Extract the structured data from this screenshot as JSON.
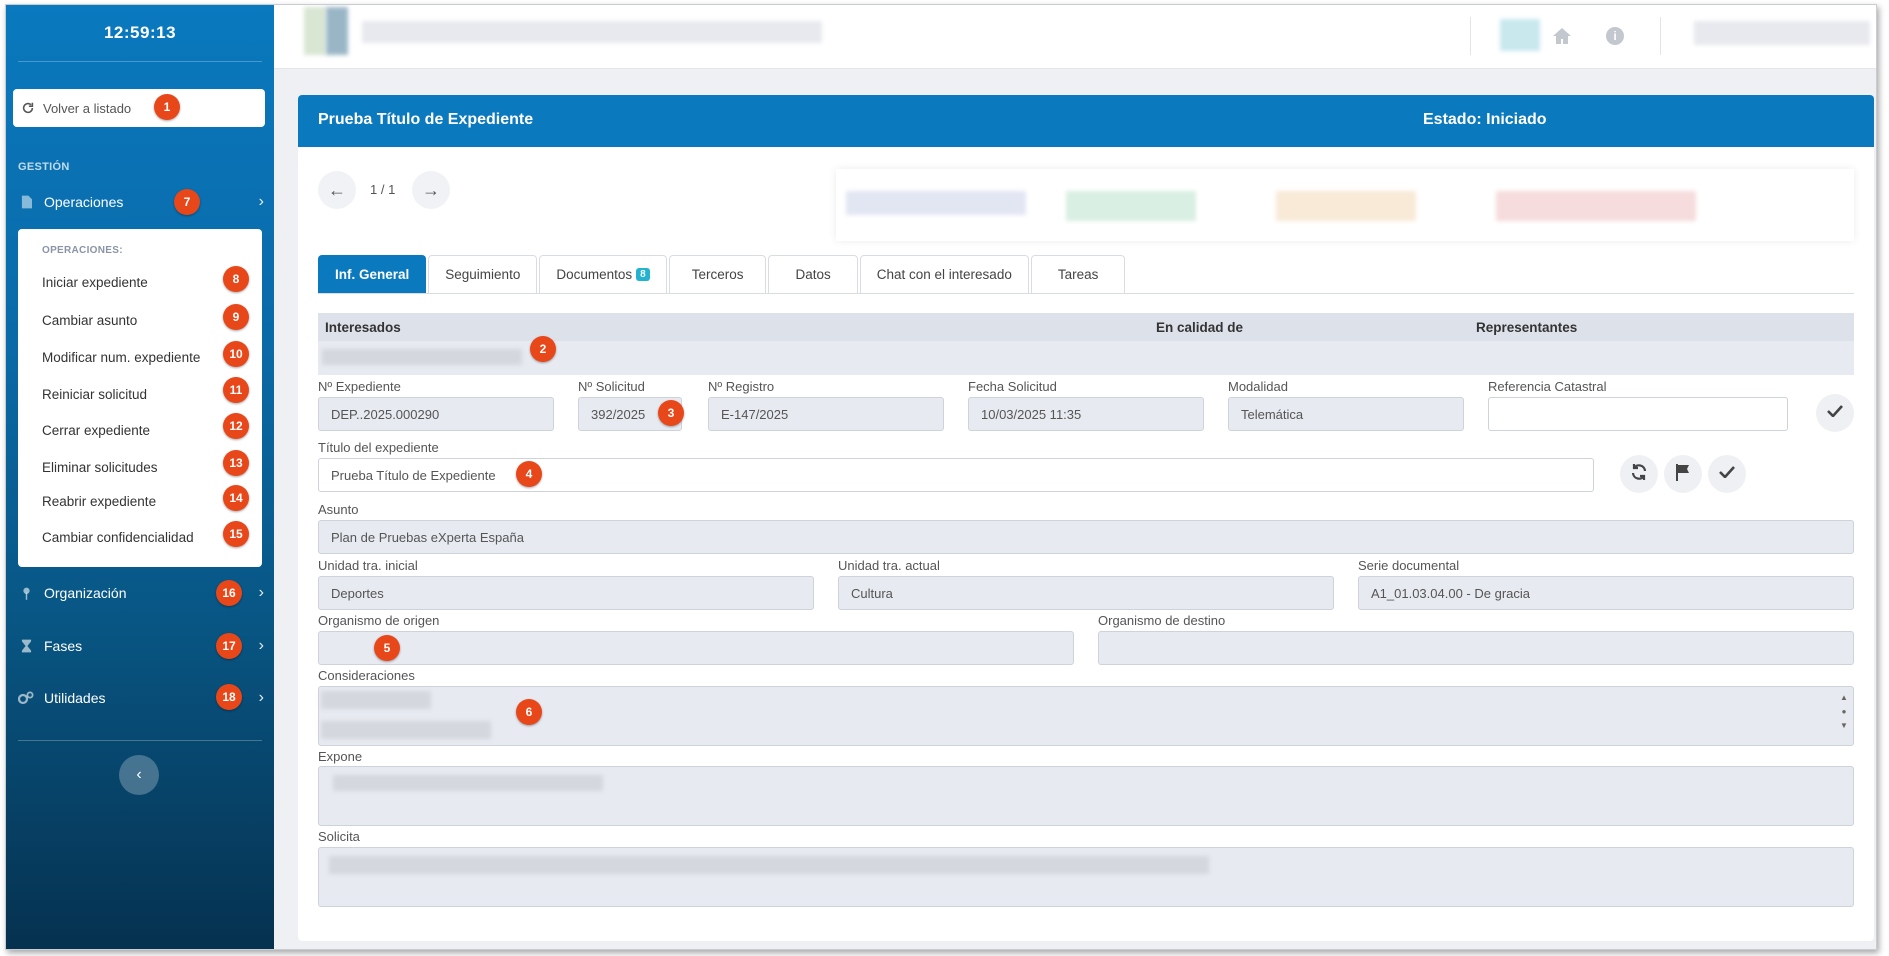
{
  "sidebar": {
    "clock": "12:59:13",
    "back_label": "Volver a listado",
    "section": "GESTIÓN",
    "operaciones_label": "Operaciones",
    "submenu_title": "OPERACIONES:",
    "submenu_items": [
      "Iniciar expediente",
      "Cambiar asunto",
      "Modificar num. expediente",
      "Reiniciar solicitud",
      "Cerrar expediente",
      "Eliminar solicitudes",
      "Reabrir expediente",
      "Cambiar confidencialidad"
    ],
    "items": [
      {
        "label": "Organización"
      },
      {
        "label": "Fases"
      },
      {
        "label": "Utilidades"
      }
    ],
    "collapse_icon": "chevron-left-icon"
  },
  "badges": [
    "1",
    "2",
    "3",
    "4",
    "5",
    "6",
    "7",
    "8",
    "9",
    "10",
    "11",
    "12",
    "13",
    "14",
    "15",
    "16",
    "17",
    "18"
  ],
  "card": {
    "title": "Prueba Título de Expediente",
    "state": "Estado: Iniciado",
    "pager": "1 / 1"
  },
  "tabs": [
    {
      "label": "Inf. General",
      "active": true
    },
    {
      "label": "Seguimiento"
    },
    {
      "label": "Documentos",
      "count": "8"
    },
    {
      "label": "Terceros"
    },
    {
      "label": "Datos"
    },
    {
      "label": "Chat con el interesado"
    },
    {
      "label": "Tareas"
    }
  ],
  "interesados": {
    "col1": "Interesados",
    "col2": "En calidad de",
    "col3": "Representantes"
  },
  "fields": {
    "expediente": {
      "label": "Nº Expediente",
      "value": "DEP..2025.000290"
    },
    "solicitud": {
      "label": "Nº Solicitud",
      "value": "392/2025"
    },
    "registro": {
      "label": "Nº Registro",
      "value": "E-147/2025"
    },
    "fecha": {
      "label": "Fecha Solicitud",
      "value": "10/03/2025 11:35"
    },
    "modalidad": {
      "label": "Modalidad",
      "value": "Telemática"
    },
    "catastral": {
      "label": "Referencia Catastral",
      "value": ""
    },
    "titulo": {
      "label": "Título del expediente",
      "value": "Prueba Título de Expediente"
    },
    "asunto": {
      "label": "Asunto",
      "value": "Plan de Pruebas eXperta España"
    },
    "unidad_inicial": {
      "label": "Unidad tra. inicial",
      "value": "Deportes"
    },
    "unidad_actual": {
      "label": "Unidad tra. actual",
      "value": "Cultura"
    },
    "serie": {
      "label": "Serie documental",
      "value": "A1_01.03.04.00 - De gracia"
    },
    "org_origen": {
      "label": "Organismo de origen",
      "value": ""
    },
    "org_destino": {
      "label": "Organismo de destino",
      "value": ""
    },
    "consideraciones": {
      "label": "Consideraciones"
    },
    "expone": {
      "label": "Expone"
    },
    "solicita": {
      "label": "Solicita"
    }
  },
  "colors": {
    "primary": "#0b79be",
    "badge": "#e8471a",
    "field_bg": "#e8eaf1",
    "docs_count": "#23b3d1"
  }
}
